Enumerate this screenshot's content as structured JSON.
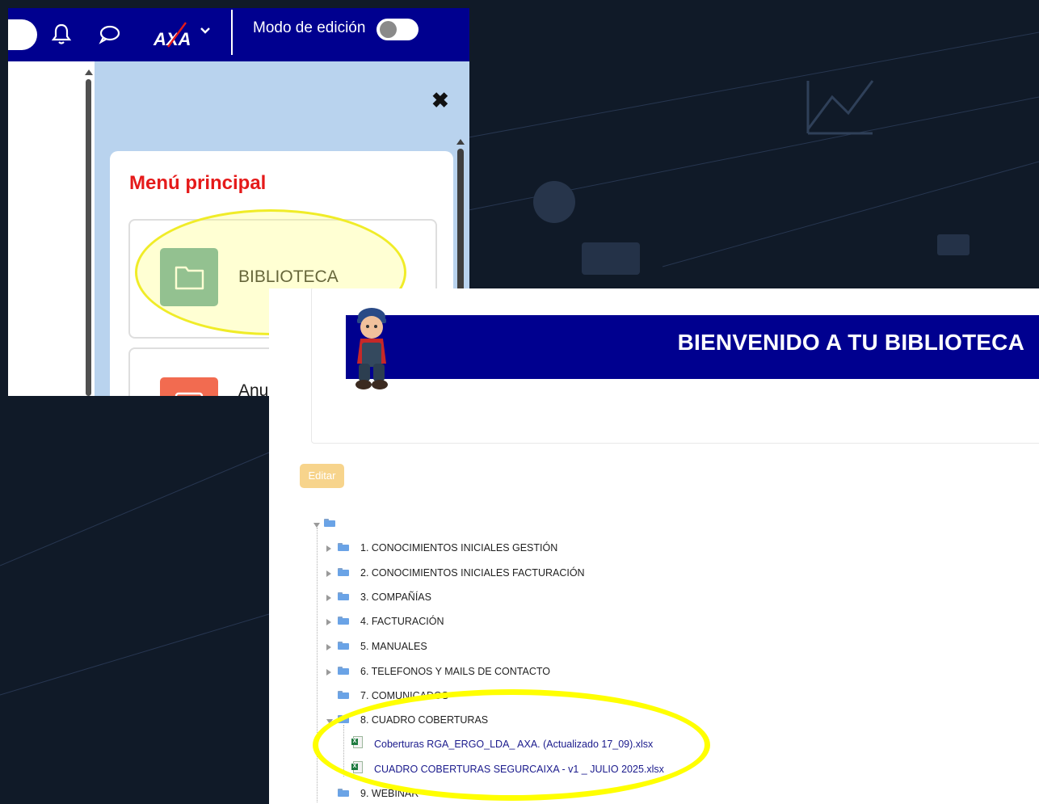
{
  "top_panel": {
    "topbar": {
      "bell_icon": "bell-icon",
      "chat_icon": "chat-bubble-icon",
      "logo": "AXA",
      "edit_mode_label": "Modo de edición",
      "edit_mode_on": false,
      "background": "#00008f"
    },
    "drawer": {
      "close_glyph": "✖",
      "menu_title": "Menú principal",
      "items": [
        {
          "label": "BIBLIOTECA",
          "icon": "folder-icon",
          "color": "#5fa39c"
        },
        {
          "label": "Anur",
          "icon": "announcement-icon",
          "color": "#f26b50"
        }
      ]
    },
    "highlight_color": "#f0ec28"
  },
  "bottom_panel": {
    "banner_title": "BIENVENIDO A TU BIBLIOTECA",
    "banner_color": "#00008f",
    "edit_button": "Editar",
    "tree": {
      "root_icon": "folder-icon",
      "folders": [
        {
          "label": "1. CONOCIMIENTOS INICIALES GESTIÓN",
          "state": "collapsed"
        },
        {
          "label": "2. CONOCIMIENTOS INICIALES FACTURACIÓN",
          "state": "collapsed"
        },
        {
          "label": "3. COMPAÑÍAS",
          "state": "collapsed"
        },
        {
          "label": "4. FACTURACIÓN",
          "state": "collapsed"
        },
        {
          "label": "5. MANUALES",
          "state": "collapsed"
        },
        {
          "label": "6. TELEFONOS Y MAILS DE CONTACTO",
          "state": "collapsed"
        },
        {
          "label": "7. COMUNICADOS",
          "state": "leaf"
        },
        {
          "label": "8. CUADRO COBERTURAS",
          "state": "expanded"
        },
        {
          "label": "9. WEBINAR",
          "state": "leaf"
        }
      ],
      "files": [
        {
          "label": "Coberturas RGA_ERGO_LDA_ AXA. (Actualizado 17_09).xlsx",
          "icon": "excel-file-icon"
        },
        {
          "label": "CUADRO COBERTURAS SEGURCAIXA - v1 _ JULIO 2025.xlsx",
          "icon": "excel-file-icon"
        }
      ]
    },
    "highlight_color": "#ffff00"
  }
}
